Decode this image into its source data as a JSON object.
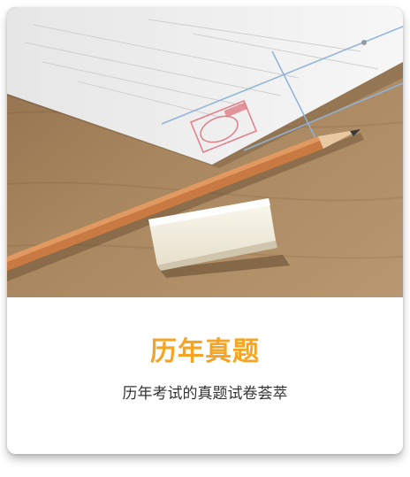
{
  "card": {
    "title": "历年真题",
    "subtitle": "历年考试的真题试卷荟萃",
    "title_color": "#f5a523"
  },
  "photo": {
    "icons": [
      "exam-paper-icon",
      "pencil-icon",
      "eraser-icon"
    ]
  }
}
